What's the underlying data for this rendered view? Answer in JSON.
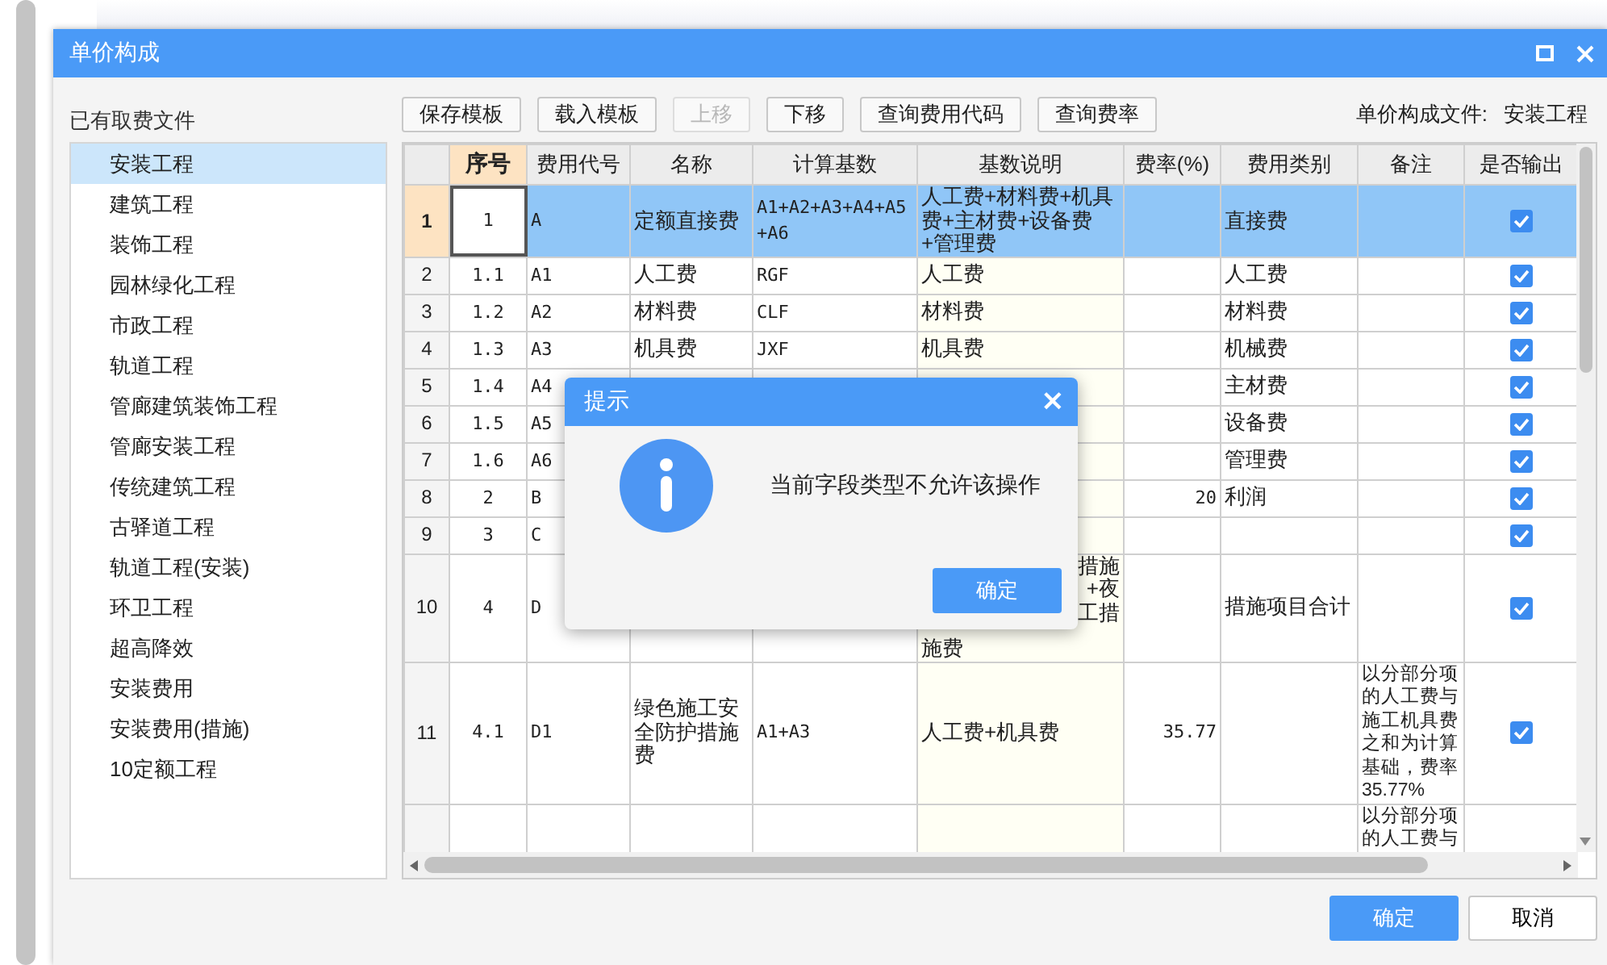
{
  "window": {
    "title": "单价构成"
  },
  "sidebar": {
    "label": "已有取费文件",
    "items": [
      {
        "label": "安装工程",
        "selected": true
      },
      {
        "label": "建筑工程",
        "selected": false
      },
      {
        "label": "装饰工程",
        "selected": false
      },
      {
        "label": "园林绿化工程",
        "selected": false
      },
      {
        "label": "市政工程",
        "selected": false
      },
      {
        "label": "轨道工程",
        "selected": false
      },
      {
        "label": "管廊建筑装饰工程",
        "selected": false
      },
      {
        "label": "管廊安装工程",
        "selected": false
      },
      {
        "label": "传统建筑工程",
        "selected": false
      },
      {
        "label": "古驿道工程",
        "selected": false
      },
      {
        "label": "轨道工程(安装)",
        "selected": false
      },
      {
        "label": "环卫工程",
        "selected": false
      },
      {
        "label": "超高降效",
        "selected": false
      },
      {
        "label": "安装费用",
        "selected": false
      },
      {
        "label": "安装费用(措施)",
        "selected": false
      },
      {
        "label": "10定额工程",
        "selected": false
      }
    ]
  },
  "toolbar": {
    "buttons": [
      {
        "label": "保存模板",
        "disabled": false
      },
      {
        "label": "载入模板",
        "disabled": false
      },
      {
        "label": "上移",
        "disabled": true
      },
      {
        "label": "下移",
        "disabled": false
      },
      {
        "label": "查询费用代码",
        "disabled": false
      },
      {
        "label": "查询费率",
        "disabled": false
      }
    ],
    "file_label": "单价构成文件:",
    "file_value": "安装工程"
  },
  "table": {
    "columns": [
      "序号",
      "费用代号",
      "名称",
      "计算基数",
      "基数说明",
      "费率(%)",
      "费用类别",
      "备注",
      "是否输出"
    ],
    "rows": [
      {
        "num": "1",
        "seq": "1",
        "code": "A",
        "name": "定额直接费",
        "base": "A1+A2+A3+A4+A5+A6",
        "explain": "人工费+材料费+机具费+主材费+设备费+管理费",
        "category": "直接费",
        "output": true,
        "selected": true
      },
      {
        "num": "2",
        "seq": "1.1",
        "code": "A1",
        "name": "人工费",
        "base": "RGF",
        "explain": "人工费",
        "category": "人工费",
        "output": true,
        "selected": false
      },
      {
        "num": "3",
        "seq": "1.2",
        "code": "A2",
        "name": "材料费",
        "base": "CLF",
        "explain": "材料费",
        "category": "材料费",
        "output": true,
        "selected": false
      },
      {
        "num": "4",
        "seq": "1.3",
        "code": "A3",
        "name": "机具费",
        "base": "JXF",
        "explain": "机具费",
        "category": "机械费",
        "output": true,
        "selected": false
      },
      {
        "num": "5",
        "seq": "1.4",
        "code": "A4",
        "category": "主材费",
        "output": true,
        "selected": false
      },
      {
        "num": "6",
        "seq": "1.5",
        "code": "A5",
        "category": "设备费",
        "output": true,
        "selected": false
      },
      {
        "num": "7",
        "seq": "1.6",
        "code": "A6",
        "category": "管理费",
        "output": true,
        "selected": false
      },
      {
        "num": "8",
        "seq": "2",
        "code": "B",
        "rate": "20",
        "category": "利润",
        "output": true,
        "selected": false
      },
      {
        "num": "9",
        "seq": "3",
        "code": "C",
        "output": true,
        "selected": false
      },
      {
        "num": "10",
        "seq": "4",
        "code": "D",
        "explain_fragments": [
          "措施",
          "+夜",
          "工措",
          "施费"
        ],
        "category": "措施项目合计",
        "output": true,
        "selected": false
      },
      {
        "num": "11",
        "seq": "4.1",
        "code": "D1",
        "name": "绿色施工安全防护措施费",
        "base": "A1+A3",
        "explain": "人工费+机具费",
        "rate": "35.77",
        "note": "以分部分项的人工费与施工机具费之和为计算基础，费率35.77%",
        "output": true,
        "selected": false
      },
      {
        "note": "以分部分项的人工费与"
      }
    ]
  },
  "footer": {
    "buttons": [
      {
        "label": "确定",
        "kind": "primary"
      },
      {
        "label": "取消",
        "kind": "normal"
      }
    ]
  },
  "dialog": {
    "title": "提示",
    "close": "×",
    "message": "当前字段类型不允许该操作",
    "button": "确定"
  }
}
